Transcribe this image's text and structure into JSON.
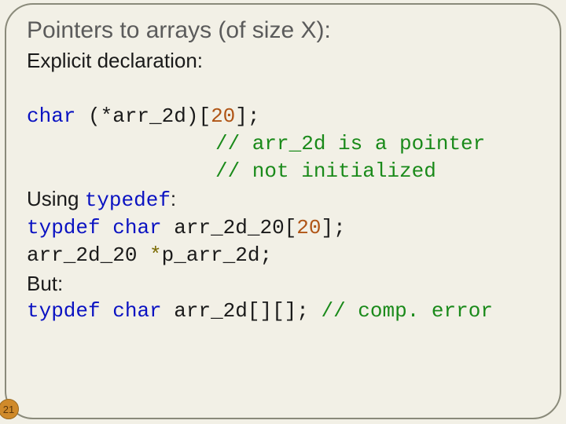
{
  "title": "Pointers to arrays (of size X):",
  "subhead": "Explicit declaration:",
  "code": {
    "l1": {
      "kw_char": "char",
      "rest1": " (*arr_2d)[",
      "num": "20",
      "rest2": "];"
    },
    "c1": "// arr_2d is a pointer",
    "c2": "// not initialized",
    "l2": {
      "pre": "Using ",
      "kw": "typedef",
      "post": ":"
    },
    "l3": {
      "kw1": "typdef",
      "kw2": "char",
      "mid": " arr_2d_20[",
      "num": "20",
      "end": "];"
    },
    "l4": {
      "pre": "arr_2d_20 ",
      "op": "*",
      "post": "p_arr_2d;"
    },
    "l5": "But:",
    "l6": {
      "kw1": "typdef",
      "kw2": "char",
      "mid": " arr_2d[][]; ",
      "cmt": "// comp. error"
    }
  },
  "page_number": "21"
}
